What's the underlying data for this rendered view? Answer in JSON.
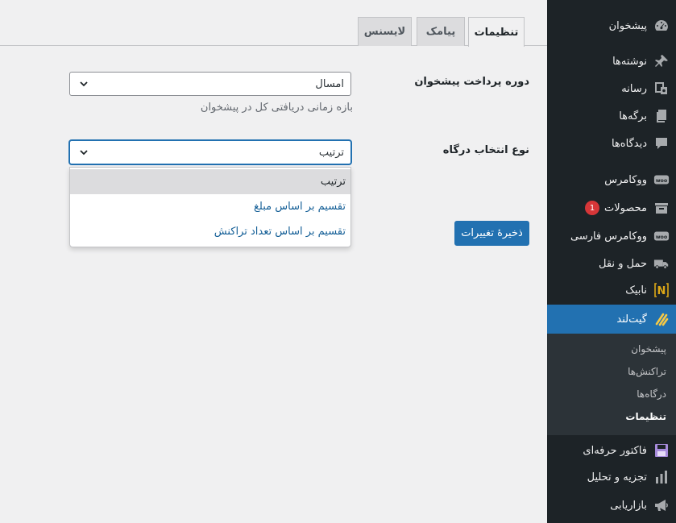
{
  "tabs": [
    {
      "label": "تنظیمات",
      "active": true
    },
    {
      "label": "پیامک",
      "active": false
    },
    {
      "label": "لایسنس",
      "active": false
    }
  ],
  "form": {
    "period": {
      "label": "دوره پرداخت پیشخوان",
      "value": "امسال",
      "description": "بازه زمانی دریافتی کل در پیشخوان"
    },
    "gateway_selection": {
      "label": "نوع انتخاب درگاه",
      "value": "ترتیب",
      "options": [
        "ترتیب",
        "تقسیم بر اساس مبلغ",
        "تقسیم بر اساس تعداد تراکنش"
      ]
    },
    "save_label": "ذخیرهٔ تغییرات"
  },
  "sidebar": {
    "items": [
      {
        "label": "پیشخوان",
        "icon": "dashboard-icon"
      },
      {
        "label": "نوشته‌ها",
        "icon": "pin-icon"
      },
      {
        "label": "رسانه",
        "icon": "media-icon"
      },
      {
        "label": "برگه‌ها",
        "icon": "pages-icon"
      },
      {
        "label": "دیدگاه‌ها",
        "icon": "comments-icon"
      },
      {
        "label": "ووکامرس",
        "icon": "woo-icon",
        "icon_text": "woo"
      },
      {
        "label": "محصولات",
        "icon": "archive-icon",
        "badge": "1"
      },
      {
        "label": "ووکامرس فارسی",
        "icon": "woo-icon",
        "icon_text": "woo"
      },
      {
        "label": "حمل و نقل",
        "icon": "truck-icon"
      },
      {
        "label": "نابیک",
        "icon": "nabik-icon",
        "icon_text": "N"
      },
      {
        "label": "گیت‌لند",
        "icon": "gateland-icon",
        "active": true
      },
      {
        "label": "فاکتور حرفه‌ای",
        "icon": "floppy-icon"
      },
      {
        "label": "تجزیه و تحلیل",
        "icon": "chart-icon"
      },
      {
        "label": "بازاریابی",
        "icon": "megaphone-icon"
      }
    ],
    "submenu": [
      {
        "label": "پیشخوان",
        "current": false
      },
      {
        "label": "تراکنش‌ها",
        "current": false
      },
      {
        "label": "درگاه‌ها",
        "current": false
      },
      {
        "label": "تنظیمات",
        "current": true
      }
    ]
  },
  "colors": {
    "sidebar_bg": "#1d2327",
    "submenu_bg": "#2c3338",
    "accent": "#2271b1",
    "page_bg": "#f0f0f1",
    "badge": "#d63638"
  }
}
